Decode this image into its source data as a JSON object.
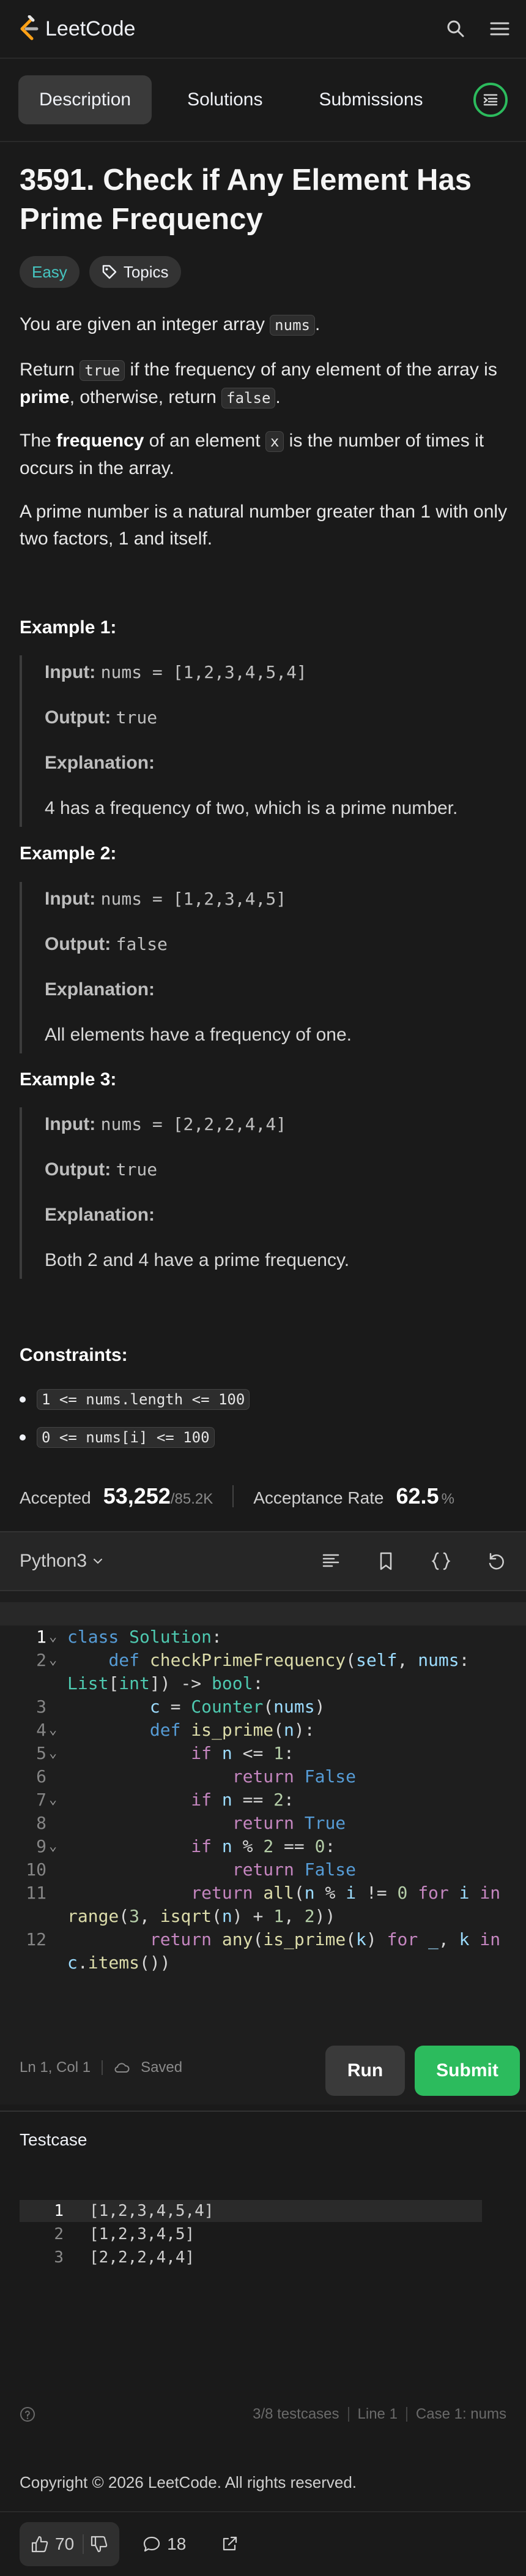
{
  "nav": {
    "logo_text": "LeetCode",
    "search_icon": "search-icon",
    "menu_icon": "menu-icon"
  },
  "tabs": [
    {
      "label": "Description"
    },
    {
      "label": "Solutions"
    },
    {
      "label": "Submissions"
    }
  ],
  "problem": {
    "title": "3591. Check if Any Element Has Prime Frequency",
    "difficulty": "Easy",
    "topics_label": "Topics",
    "intro_pre": "You are given an integer array ",
    "intro_code": "nums",
    "intro_post": ".",
    "return_pre": "Return ",
    "return_true": "true",
    "return_mid1": " if the frequency of any element of the array is ",
    "return_prime": "prime",
    "return_mid2": ", otherwise, return ",
    "return_false": "false",
    "return_post": ".",
    "freq_pre": "The ",
    "freq_bold": "frequency",
    "freq_mid": " of an element ",
    "freq_code": "x",
    "freq_post": " is the number of times it occurs in the array.",
    "prime_def": "A prime number is a natural number greater than 1 with only two factors, 1 and itself."
  },
  "examples": [
    {
      "title": "Example 1:",
      "input": "nums = [1,2,3,4,5,4]",
      "output": "true",
      "explanation": "4 has a frequency of two, which is a prime number."
    },
    {
      "title": "Example 2:",
      "input": "nums = [1,2,3,4,5]",
      "output": "false",
      "explanation": "All elements have a frequency of one."
    },
    {
      "title": "Example 3:",
      "input": "nums = [2,2,2,4,4]",
      "output": "true",
      "explanation": "Both 2 and 4 have a prime frequency."
    }
  ],
  "labels": {
    "input": "Input:",
    "output": "Output:",
    "explanation": "Explanation:"
  },
  "constraints": {
    "title": "Constraints:",
    "items": [
      "1 <= nums.length <= 100",
      "0 <= nums[i] <= 100"
    ]
  },
  "stats": {
    "accepted_label": "Accepted",
    "accepted_value": "53,252",
    "accepted_total": "/85.2K",
    "rate_label": "Acceptance Rate",
    "rate_value": "62.5",
    "rate_unit": "%"
  },
  "editor": {
    "language": "Python3",
    "code_lines": [
      "class Solution:",
      "    def checkPrimeFrequency(self, nums:",
      "List[int]) -> bool:",
      "        c = Counter(nums)",
      "        def is_prime(n):",
      "            if n <= 1:",
      "                return False",
      "            if n == 2:",
      "                return True",
      "            if n % 2 == 0:",
      "                return False",
      "            return all(n % i != 0 for i in",
      "range(3, isqrt(n) + 1, 2))",
      "        return any(is_prime(k) for _, k in",
      "c.items())"
    ],
    "line_numbers": [
      "1",
      "2",
      "",
      "3",
      "4",
      "5",
      "6",
      "7",
      "8",
      "9",
      "10",
      "11",
      "",
      "12",
      ""
    ],
    "cursor": "Ln 1, Col 1",
    "saved": "Saved",
    "run_label": "Run",
    "submit_label": "Submit"
  },
  "testcase": {
    "title": "Testcase",
    "rows": [
      {
        "n": "1",
        "v": "[1,2,3,4,5,4]"
      },
      {
        "n": "2",
        "v": "[1,2,3,4,5]"
      },
      {
        "n": "3",
        "v": "[2,2,2,4,4]"
      }
    ],
    "footer_count": "3/8 testcases",
    "footer_line": "Line 1",
    "footer_case": "Case 1: nums"
  },
  "footer": {
    "copyright": "Copyright © 2026 LeetCode. All rights reserved.",
    "likes": "70",
    "comments": "18"
  },
  "colors": {
    "accent_green": "#2cbb5d",
    "easy": "#46c6c2",
    "background": "#1a1a1a"
  }
}
